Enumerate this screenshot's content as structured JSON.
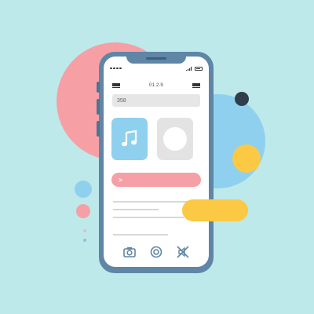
{
  "colors": {
    "background": "#bde9ea",
    "pink_circle": "#f6a0a6",
    "blue_circle": "#8fd0ee",
    "yellow_accent": "#fbc943",
    "dark_dot": "#2f3d4c",
    "phone_frame": "#5f86a6"
  },
  "status_bar": {
    "signal_icon": "signal-icon",
    "battery_icon": "battery-icon"
  },
  "nav": {
    "title": "01.2.9",
    "left_icon": "menu-icon",
    "right_icon": "menu-icon"
  },
  "search": {
    "value": "358"
  },
  "tiles": {
    "music_icon": "music-note-icon",
    "record_icon": "record-circle-icon"
  },
  "play_bar": {
    "label": ">"
  },
  "bottom_bar": {
    "icons": [
      "camera-icon",
      "target-icon",
      "mute-icon"
    ]
  }
}
